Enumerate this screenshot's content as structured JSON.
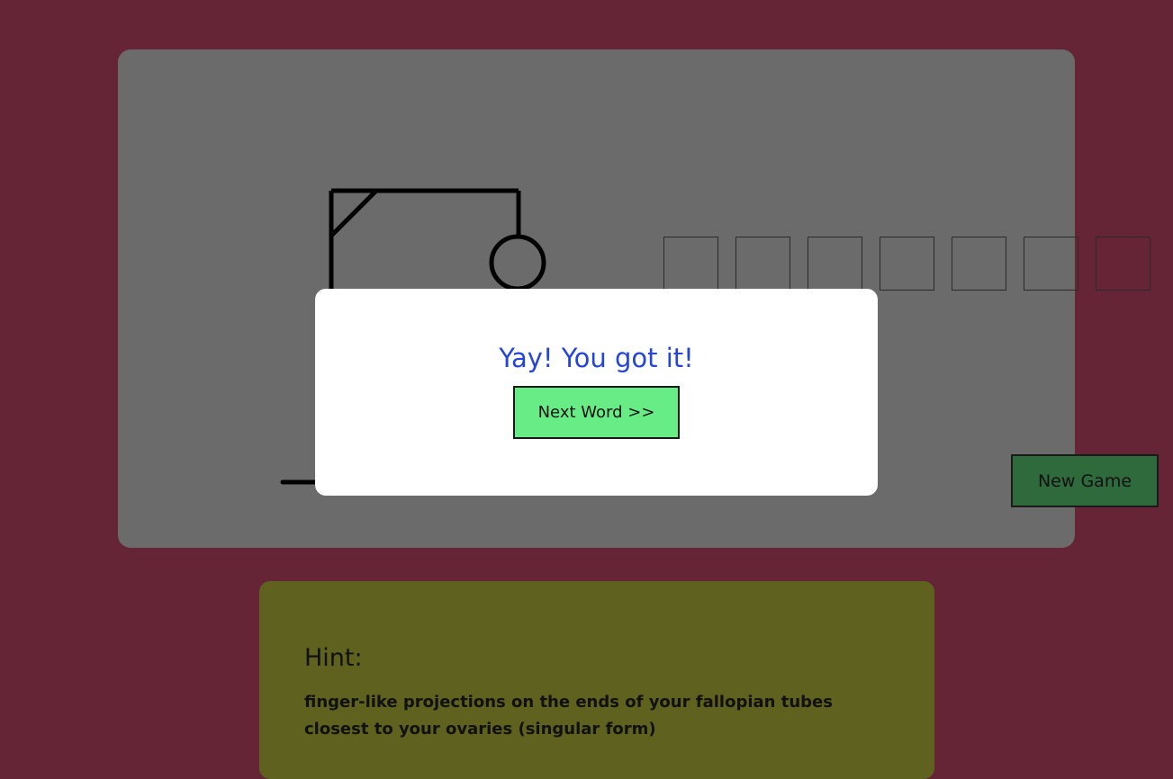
{
  "modal": {
    "title": "Yay! You got it!",
    "next_label": "Next Word >>"
  },
  "controls": {
    "new_game_label": "New Game"
  },
  "word": {
    "slots": [
      "",
      "",
      "",
      "",
      "",
      "",
      ""
    ]
  },
  "hint": {
    "title": "Hint:",
    "text": "finger-like projections on the ends of your fallopian tubes closest to your ovaries (singular form)"
  },
  "colors": {
    "page_background": "#662437",
    "game_panel": "#6b6b6b",
    "modal_title": "#2445d6",
    "next_button": "#68ec86",
    "new_game_button": "#2f6a3d",
    "hint_panel": "#5f611f"
  }
}
